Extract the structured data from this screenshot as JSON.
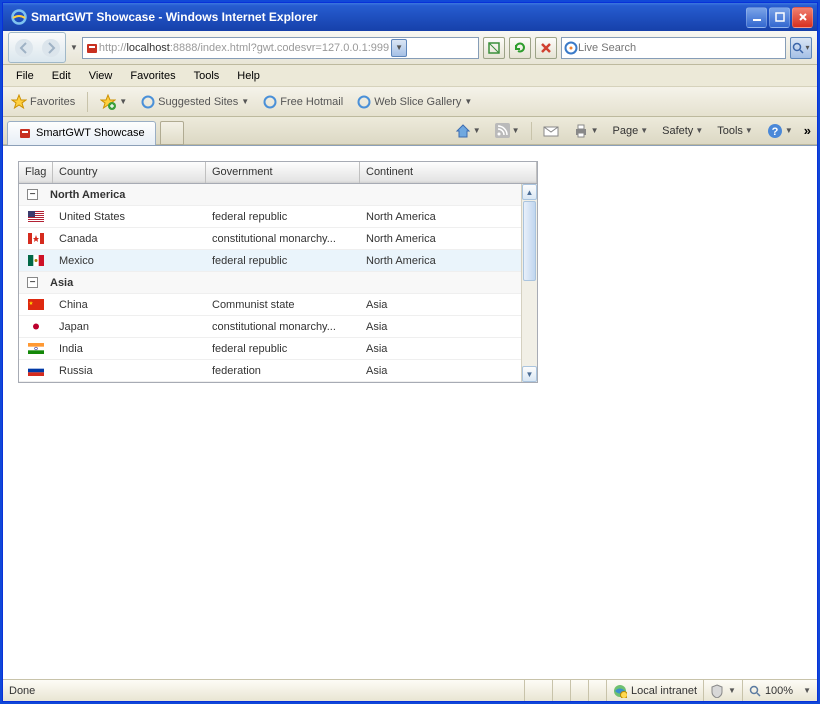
{
  "window": {
    "title": "SmartGWT Showcase - Windows Internet Explorer"
  },
  "url": {
    "prefix": "http://",
    "host": "localhost",
    "rest": ":8888/index.html?gwt.codesvr=127.0.0.1:999"
  },
  "search": {
    "placeholder": "Live Search"
  },
  "menu": {
    "file": "File",
    "edit": "Edit",
    "view": "View",
    "favorites": "Favorites",
    "tools": "Tools",
    "help": "Help"
  },
  "fav": {
    "label": "Favorites",
    "suggested": "Suggested Sites",
    "hotmail": "Free Hotmail",
    "slice": "Web Slice Gallery"
  },
  "tab": {
    "label": "SmartGWT Showcase"
  },
  "toolbar": {
    "page": "Page",
    "safety": "Safety",
    "tools": "Tools"
  },
  "grid": {
    "headers": {
      "flag": "Flag",
      "country": "Country",
      "government": "Government",
      "continent": "Continent"
    },
    "groups": [
      {
        "name": "North America",
        "rows": [
          {
            "flag": "us",
            "country": "United States",
            "gov": "federal republic",
            "cont": "North America",
            "hl": false
          },
          {
            "flag": "ca",
            "country": "Canada",
            "gov": "constitutional monarchy...",
            "cont": "North America",
            "hl": false
          },
          {
            "flag": "mx",
            "country": "Mexico",
            "gov": "federal republic",
            "cont": "North America",
            "hl": true
          }
        ]
      },
      {
        "name": "Asia",
        "rows": [
          {
            "flag": "cn",
            "country": "China",
            "gov": "Communist state",
            "cont": "Asia",
            "hl": false
          },
          {
            "flag": "jp",
            "country": "Japan",
            "gov": "constitutional monarchy...",
            "cont": "Asia",
            "hl": false
          },
          {
            "flag": "in",
            "country": "India",
            "gov": "federal republic",
            "cont": "Asia",
            "hl": false
          },
          {
            "flag": "ru",
            "country": "Russia",
            "gov": "federation",
            "cont": "Asia",
            "hl": false
          }
        ]
      }
    ]
  },
  "status": {
    "done": "Done",
    "zone": "Local intranet",
    "zoom": "100%"
  }
}
